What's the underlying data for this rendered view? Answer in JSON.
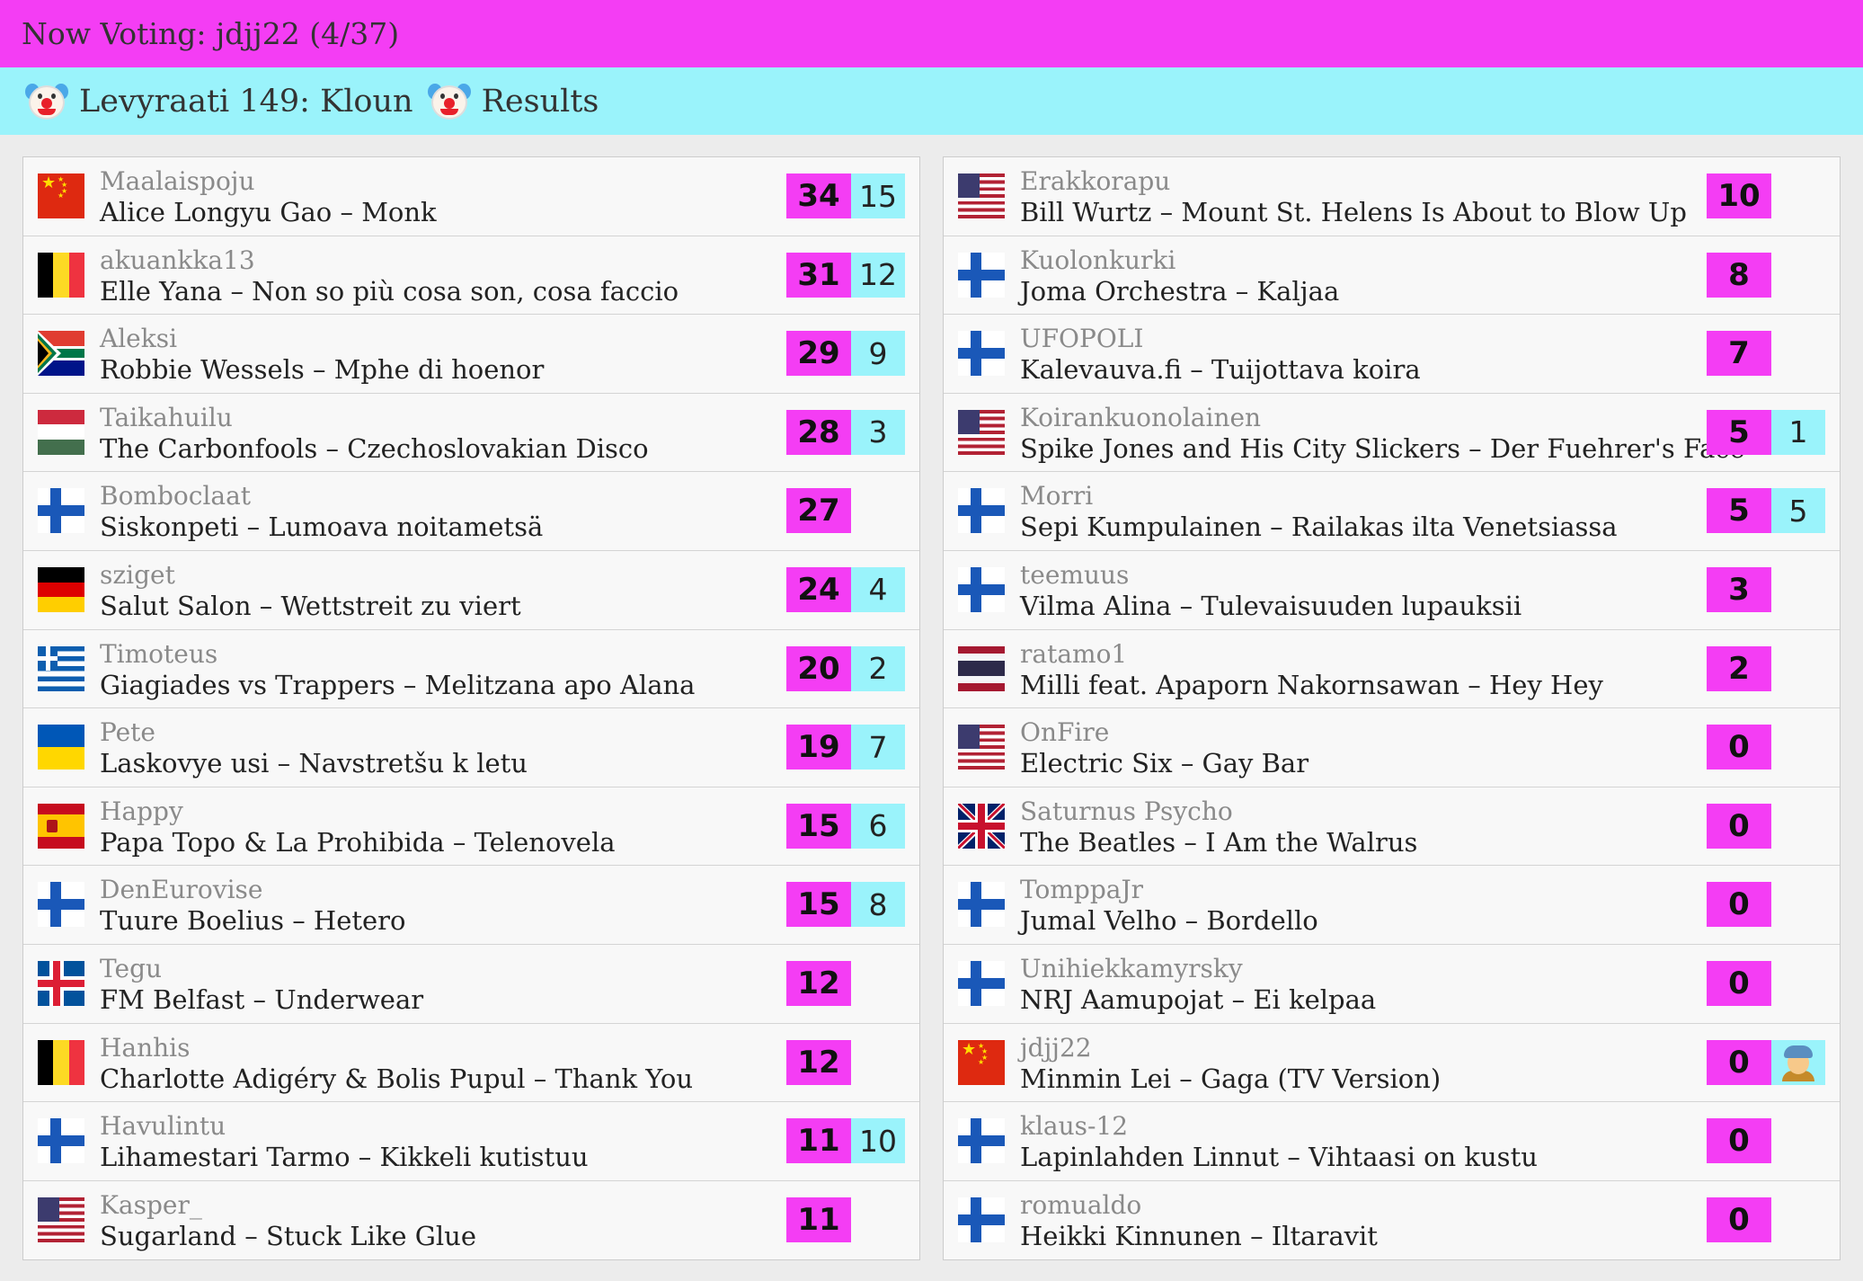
{
  "header": {
    "now_voting": "Now Voting: jdjj22 (4/37)",
    "title": "Levyraati 149: Kloun",
    "results_label": "Results"
  },
  "left": [
    {
      "flag": "cn",
      "user": "Maalaispoju",
      "song": "Alice Longyu Gao – Monk",
      "points": "34",
      "rank": "15"
    },
    {
      "flag": "be",
      "user": "akuankka13",
      "song": "Elle Yana – Non so più cosa son, cosa faccio",
      "points": "31",
      "rank": "12"
    },
    {
      "flag": "za",
      "user": "Aleksi",
      "song": "Robbie Wessels – Mphe di hoenor",
      "points": "29",
      "rank": "9"
    },
    {
      "flag": "hu",
      "user": "Taikahuilu",
      "song": "The Carbonfools – Czechoslovakian Disco",
      "points": "28",
      "rank": "3"
    },
    {
      "flag": "fi",
      "user": "Bomboclaat",
      "song": "Siskonpeti – Lumoava noitametsä",
      "points": "27",
      "rank": ""
    },
    {
      "flag": "de",
      "user": "sziget",
      "song": "Salut Salon – Wettstreit zu viert",
      "points": "24",
      "rank": "4"
    },
    {
      "flag": "gr",
      "user": "Timoteus",
      "song": "Giagiades vs Trappers – Melitzana apo Alana",
      "points": "20",
      "rank": "2"
    },
    {
      "flag": "ua",
      "user": "Pete",
      "song": "Laskovye usi – Navstretšu k letu",
      "points": "19",
      "rank": "7"
    },
    {
      "flag": "es",
      "user": "Happy",
      "song": "Papa Topo & La Prohibida – Telenovela",
      "points": "15",
      "rank": "6"
    },
    {
      "flag": "fi",
      "user": "DenEurovise",
      "song": "Tuure Boelius – Hetero",
      "points": "15",
      "rank": "8"
    },
    {
      "flag": "is",
      "user": "Tegu",
      "song": "FM Belfast – Underwear",
      "points": "12",
      "rank": ""
    },
    {
      "flag": "be",
      "user": "Hanhis",
      "song": "Charlotte Adigéry & Bolis Pupul – Thank You",
      "points": "12",
      "rank": ""
    },
    {
      "flag": "fi",
      "user": "Havulintu",
      "song": "Lihamestari Tarmo – Kikkeli kutistuu",
      "points": "11",
      "rank": "10"
    },
    {
      "flag": "us",
      "user": "Kasper_",
      "song": "Sugarland – Stuck Like Glue",
      "points": "11",
      "rank": ""
    }
  ],
  "right": [
    {
      "flag": "us",
      "user": "Erakkorapu",
      "song": "Bill Wurtz – Mount St. Helens Is About to Blow Up",
      "points": "10",
      "rank": ""
    },
    {
      "flag": "fi",
      "user": "Kuolonkurki",
      "song": "Joma Orchestra – Kaljaa",
      "points": "8",
      "rank": ""
    },
    {
      "flag": "fi",
      "user": "UFOPOLI",
      "song": "Kalevauva.fi – Tuijottava koira",
      "points": "7",
      "rank": ""
    },
    {
      "flag": "us",
      "user": "Koirankuonolainen",
      "song": "Spike Jones and His City Slickers – Der Fuehrer's Face",
      "points": "5",
      "rank": "1"
    },
    {
      "flag": "fi",
      "user": "Morri",
      "song": "Sepi Kumpulainen – Railakas ilta Venetsiassa",
      "points": "5",
      "rank": "5"
    },
    {
      "flag": "fi",
      "user": "teemuus",
      "song": "Vilma Alina – Tulevaisuuden lupauksii",
      "points": "3",
      "rank": ""
    },
    {
      "flag": "th",
      "user": "ratamo1",
      "song": "Milli feat. Apaporn Nakornsawan – Hey Hey",
      "points": "2",
      "rank": ""
    },
    {
      "flag": "us",
      "user": "OnFire",
      "song": "Electric Six – Gay Bar",
      "points": "0",
      "rank": ""
    },
    {
      "flag": "gb",
      "user": "Saturnus Psycho",
      "song": "The Beatles – I Am the Walrus",
      "points": "0",
      "rank": ""
    },
    {
      "flag": "fi",
      "user": "TomppaJr",
      "song": "Jumal Velho – Bordello",
      "points": "0",
      "rank": ""
    },
    {
      "flag": "fi",
      "user": "Unihiekkamyrsky",
      "song": "NRJ Aamupojat – Ei kelpaa",
      "points": "0",
      "rank": ""
    },
    {
      "flag": "cn",
      "user": "jdjj22",
      "song": "Minmin Lei – Gaga (TV Version)",
      "points": "0",
      "rank": "",
      "voting_icon": "person-icon"
    },
    {
      "flag": "fi",
      "user": "klaus-12",
      "song": "Lapinlahden Linnut – Vihtaasi on kustu",
      "points": "0",
      "rank": ""
    },
    {
      "flag": "fi",
      "user": "romualdo",
      "song": "Heikki Kinnunen – Iltaravit",
      "points": "0",
      "rank": ""
    }
  ],
  "colors": {
    "topbar": "#f43df4",
    "subbar": "#9af3fb",
    "points_bg": "#f43df4",
    "rank_bg": "#9af3fb"
  }
}
